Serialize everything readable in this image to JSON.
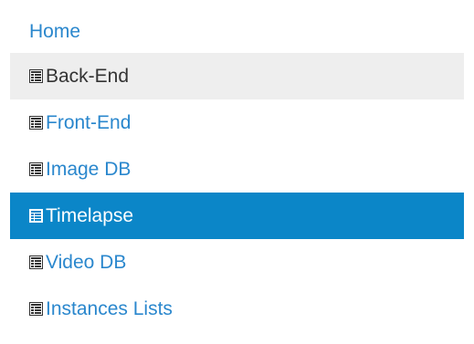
{
  "nav": {
    "items": [
      {
        "label": "Home",
        "icon": null,
        "state": "normal"
      },
      {
        "label": "Back-End",
        "icon": "list-icon",
        "state": "hover"
      },
      {
        "label": "Front-End",
        "icon": "list-icon",
        "state": "normal"
      },
      {
        "label": "Image DB",
        "icon": "list-icon",
        "state": "normal"
      },
      {
        "label": "Timelapse",
        "icon": "list-icon",
        "state": "active"
      },
      {
        "label": "Video DB",
        "icon": "list-icon",
        "state": "normal"
      },
      {
        "label": "Instances Lists",
        "icon": "list-icon",
        "state": "normal"
      }
    ]
  },
  "colors": {
    "link": "#2a87cd",
    "hover_bg": "#eeeeee",
    "hover_text": "#333333",
    "active_bg": "#0b86c8",
    "active_text": "#ffffff"
  }
}
